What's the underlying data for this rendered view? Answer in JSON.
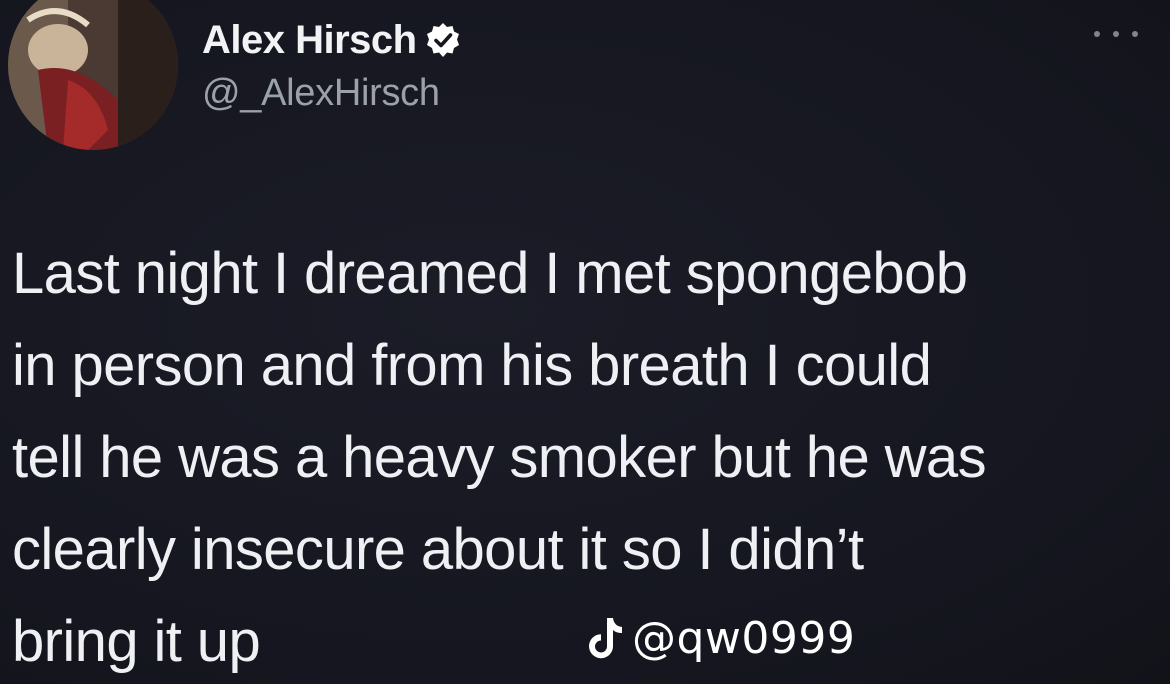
{
  "author": {
    "display_name": "Alex Hirsch",
    "handle": "@_AlexHirsch",
    "verified": true,
    "avatar_icon": "avatar-photo",
    "verified_icon": "verified-badge-icon"
  },
  "menu": {
    "icon": "more-options-icon"
  },
  "tweet": {
    "lines": [
      "Last night I dreamed I met spongebob",
      "in person and from his breath I could",
      "tell he was a heavy smoker but he was",
      "clearly insecure about it so I didn’t",
      "bring it up"
    ]
  },
  "watermark": {
    "icon": "tiktok-logo-icon",
    "text": "@qw0999"
  },
  "colors": {
    "background": "#15161f",
    "text": "#eef0f3",
    "handle": "#9aa1aa",
    "verified_badge": "#ffffff"
  }
}
